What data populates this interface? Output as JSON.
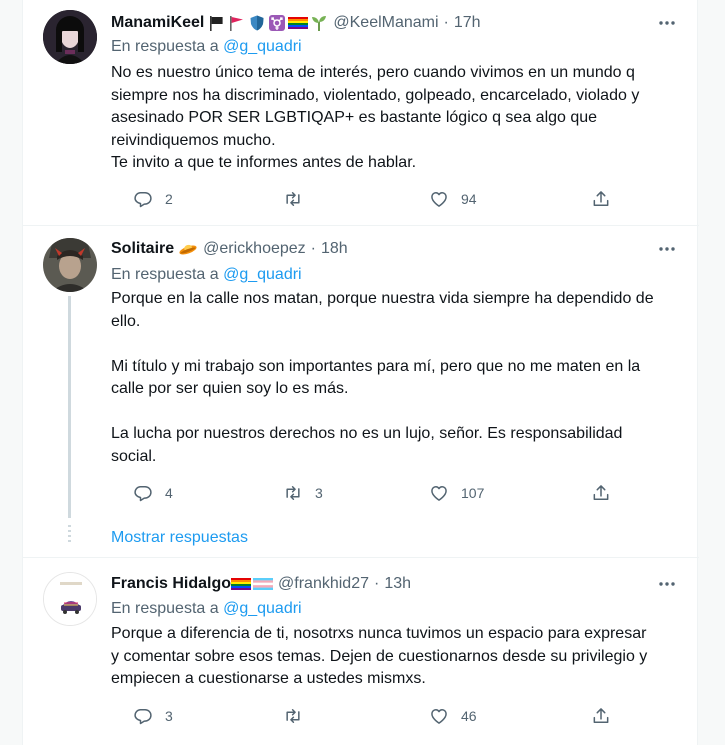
{
  "tweets": [
    {
      "name": "ManamiKeel",
      "handle": "@KeelManami",
      "time": "17h",
      "reply_prefix": "En respuesta a",
      "reply_mention": "@g_quadri",
      "text": "No es nuestro único tema de interés, pero cuando vivimos en un mundo q\nsiempre nos ha discriminado, violentado, golpeado, encarcelado, violado y\nasesinado POR SER LGBTIQAP+ es bastante lógico q sea algo que\nreivindiquemos mucho.\nTe invito a que te informes antes de hablar.",
      "replies": "2",
      "retweets": "",
      "likes": "94"
    },
    {
      "name": "Solitaire",
      "handle": "@erickhoepez",
      "time": "18h",
      "reply_prefix": "En respuesta a",
      "reply_mention": "@g_quadri",
      "text": "Porque en la calle nos matan, porque nuestra vida siempre ha dependido de\nello.\n\nMi título y mi trabajo son importantes para mí, pero que no me maten en la\ncalle por ser quien soy lo es más.\n\nLa lucha por nuestros derechos no es un lujo, señor. Es responsabilidad\nsocial.",
      "replies": "4",
      "retweets": "3",
      "likes": "107"
    },
    {
      "name": "Francis Hidalgo",
      "handle": "@frankhid27",
      "time": "13h",
      "reply_prefix": "En respuesta a",
      "reply_mention": "@g_quadri",
      "text": "Porque a diferencia de ti, nosotrxs nunca tuvimos un espacio para expresar\ny comentar sobre esos temas. Dejen de cuestionarnos desde su privilegio y\nempiecen a cuestionarse a ustedes mismxs.",
      "replies": "3",
      "retweets": "",
      "likes": "46"
    }
  ],
  "show_replies_label": "Mostrar respuestas",
  "separator_dot": "·",
  "colors": {
    "accent": "#1d9bf0",
    "secondary_text": "#536471",
    "border": "#eff3f4"
  },
  "icons": [
    "more-icon",
    "reply-icon",
    "retweet-icon",
    "like-icon",
    "share-icon"
  ]
}
